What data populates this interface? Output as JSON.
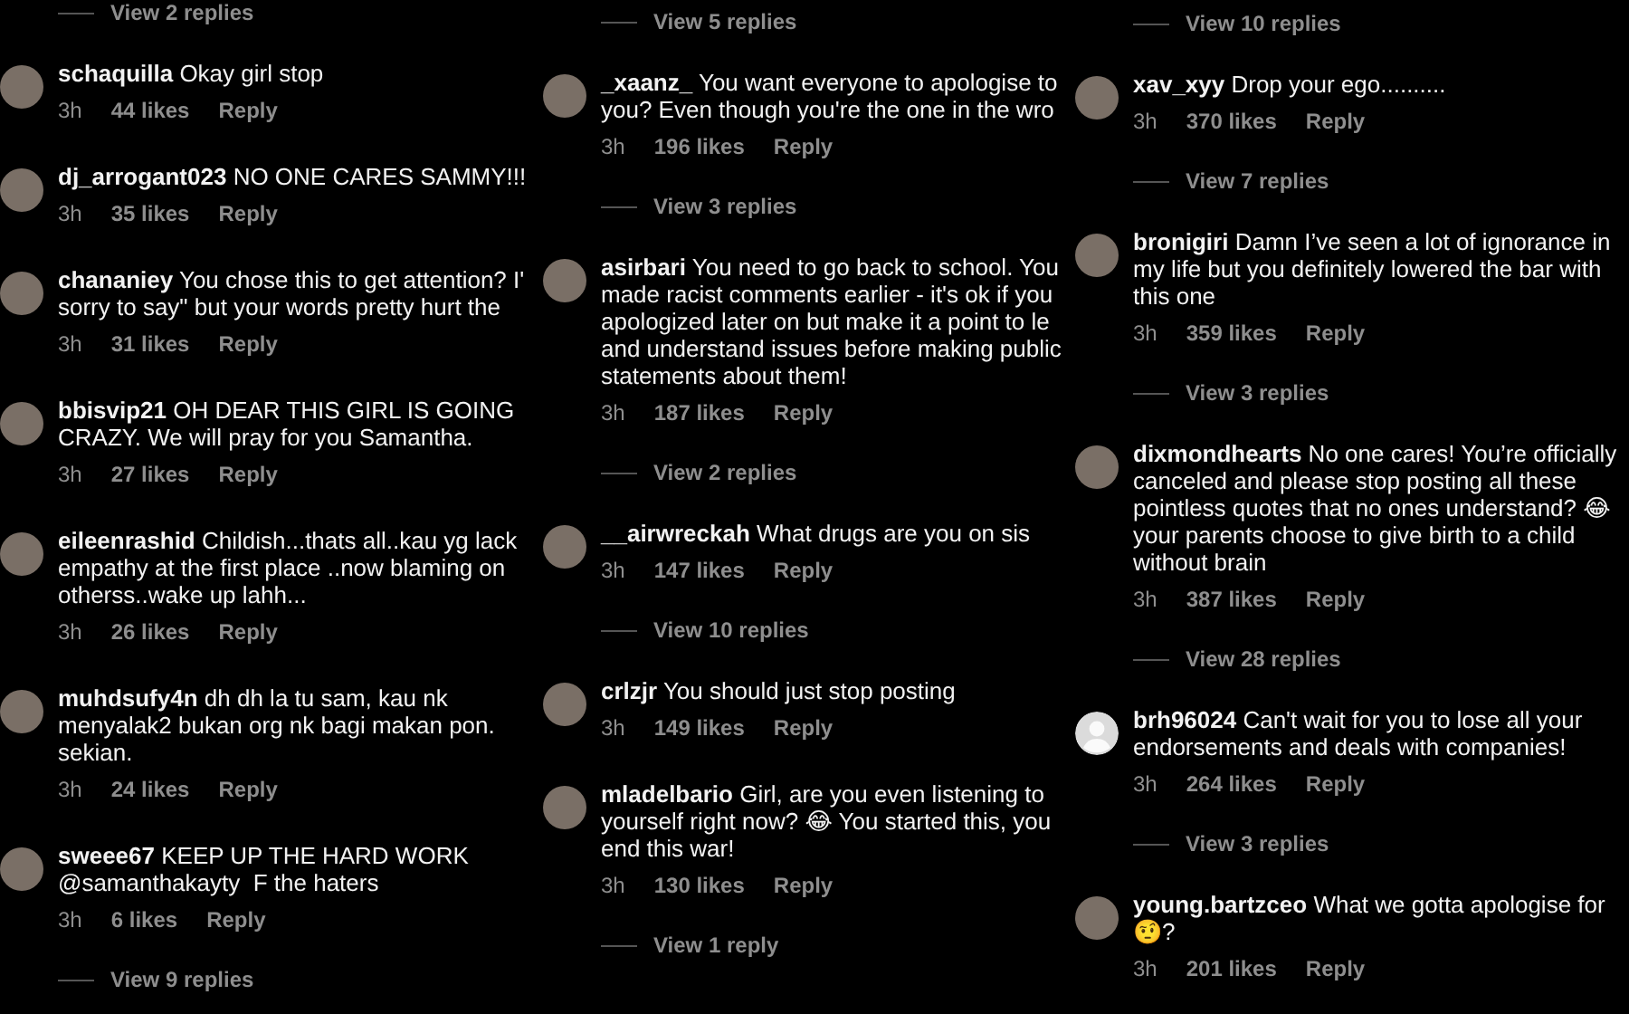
{
  "columns": [
    {
      "items": [
        {
          "kind": "replies",
          "label": "View 2 replies"
        },
        {
          "kind": "comment",
          "default_avatar": false,
          "username": "schaquilla",
          "text": "Okay girl stop",
          "time": "3h",
          "likes": "44 likes",
          "reply": "Reply"
        },
        {
          "kind": "comment",
          "default_avatar": false,
          "username": "dj_arrogant023",
          "text": "NO ONE CARES SAMMY!!!",
          "time": "3h",
          "likes": "35 likes",
          "reply": "Reply"
        },
        {
          "kind": "comment",
          "default_avatar": false,
          "username": "chananiey",
          "text": "You chose this to get attention? I'\nsorry to say\" but your words pretty hurt the",
          "time": "3h",
          "likes": "31 likes",
          "reply": "Reply"
        },
        {
          "kind": "comment",
          "default_avatar": false,
          "username": "bbisvip21",
          "text": "OH DEAR THIS GIRL IS GOING\nCRAZY. We will pray for you Samantha.",
          "time": "3h",
          "likes": "27 likes",
          "reply": "Reply"
        },
        {
          "kind": "comment",
          "default_avatar": false,
          "username": "eileenrashid",
          "text": "Childish...thats all..kau yg lack\nempathy at the first place ..now blaming on\notherss..wake up lahh...",
          "time": "3h",
          "likes": "26 likes",
          "reply": "Reply"
        },
        {
          "kind": "comment",
          "default_avatar": false,
          "username": "muhdsufy4n",
          "text": "dh dh la tu sam, kau nk\nmenyalak2 bukan org nk bagi makan pon.\nsekian.",
          "time": "3h",
          "likes": "24 likes",
          "reply": "Reply"
        },
        {
          "kind": "comment",
          "default_avatar": false,
          "username": "sweee67",
          "text": "KEEP UP THE HARD WORK\n@samanthakayty  F the haters",
          "time": "3h",
          "likes": "6 likes",
          "reply": "Reply"
        },
        {
          "kind": "replies",
          "label": "View 9 replies"
        }
      ]
    },
    {
      "items": [
        {
          "kind": "replies",
          "label": "View 5 replies"
        },
        {
          "kind": "comment",
          "default_avatar": false,
          "username": "_xaanz_",
          "text": "You want everyone to apologise to\nyou? Even though you're the one in the wro",
          "time": "3h",
          "likes": "196 likes",
          "reply": "Reply"
        },
        {
          "kind": "replies",
          "label": "View 3 replies"
        },
        {
          "kind": "comment",
          "default_avatar": false,
          "username": "asirbari",
          "text": "You need to go back to school. You\nmade racist comments earlier - it's ok if you\napologized later on but make it a point to le\nand understand issues before making public\nstatements about them!",
          "time": "3h",
          "likes": "187 likes",
          "reply": "Reply"
        },
        {
          "kind": "replies",
          "label": "View 2 replies"
        },
        {
          "kind": "comment",
          "default_avatar": false,
          "username": "__airwreckah",
          "text": "What drugs are you on sis",
          "time": "3h",
          "likes": "147 likes",
          "reply": "Reply"
        },
        {
          "kind": "replies",
          "label": "View 10 replies"
        },
        {
          "kind": "comment",
          "default_avatar": false,
          "username": "crlzjr",
          "text": "You should just stop posting",
          "time": "3h",
          "likes": "149 likes",
          "reply": "Reply"
        },
        {
          "kind": "comment",
          "default_avatar": false,
          "username": "mladelbario",
          "text": "Girl, are you even listening to\nyourself right now? 😂 You started this, you\nend this war!",
          "time": "3h",
          "likes": "130 likes",
          "reply": "Reply"
        },
        {
          "kind": "replies",
          "label": "View 1 reply"
        }
      ]
    },
    {
      "items": [
        {
          "kind": "replies",
          "label": "View 10 replies"
        },
        {
          "kind": "comment",
          "default_avatar": false,
          "username": "xav_xyy",
          "text": "Drop your ego..........",
          "time": "3h",
          "likes": "370 likes",
          "reply": "Reply"
        },
        {
          "kind": "replies",
          "label": "View 7 replies"
        },
        {
          "kind": "comment",
          "default_avatar": false,
          "username": "bronigiri",
          "text": "Damn I’ve seen a lot of ignorance in\nmy life but you definitely lowered the bar with\nthis one",
          "time": "3h",
          "likes": "359 likes",
          "reply": "Reply"
        },
        {
          "kind": "replies",
          "label": "View 3 replies"
        },
        {
          "kind": "comment",
          "default_avatar": false,
          "username": "dixmondhearts",
          "text": "No one cares! You’re officially\ncanceled and please stop posting all these\npointless quotes that no ones understand? 😂\nyour parents choose to give birth to a child\nwithout brain",
          "time": "3h",
          "likes": "387 likes",
          "reply": "Reply"
        },
        {
          "kind": "replies",
          "label": "View 28 replies"
        },
        {
          "kind": "comment",
          "default_avatar": true,
          "username": "brh96024",
          "text": "Can't wait for you to lose all your\nendorsements and deals with companies!",
          "time": "3h",
          "likes": "264 likes",
          "reply": "Reply"
        },
        {
          "kind": "replies",
          "label": "View 3 replies"
        },
        {
          "kind": "comment",
          "default_avatar": false,
          "username": "young.bartzceo",
          "text": "What we gotta apologise for\n🤨?",
          "time": "3h",
          "likes": "201 likes",
          "reply": "Reply"
        }
      ]
    }
  ]
}
